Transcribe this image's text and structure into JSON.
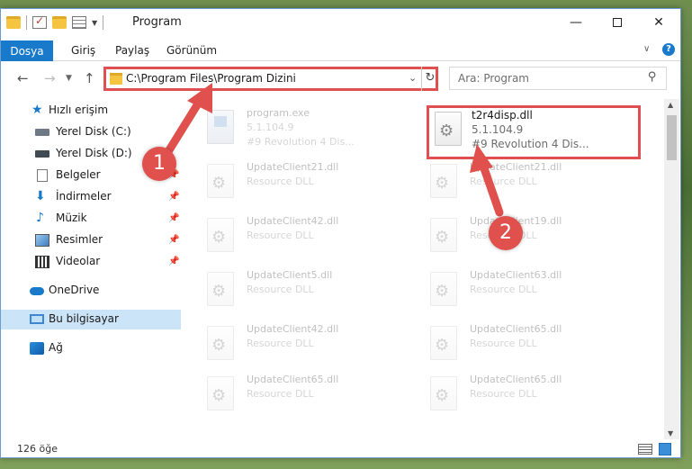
{
  "window": {
    "title": "Program",
    "controls": {
      "minimize": "—",
      "maximize": "",
      "close": "✕"
    }
  },
  "ribbon": {
    "tabs": [
      "Dosya",
      "Giriş",
      "Paylaş",
      "Görünüm"
    ],
    "help": "?"
  },
  "navigation": {
    "address_path": "C:\\Program Files\\Program Dizini",
    "search_placeholder": "Ara: Program"
  },
  "sidebar": {
    "quick_access": "Hızlı erişim",
    "items": [
      {
        "label": "Yerel Disk (C:)",
        "icon": "disk-icon",
        "pinned": false
      },
      {
        "label": "Yerel Disk (D:)",
        "icon": "disk-icon",
        "pinned": false
      },
      {
        "label": "Belgeler",
        "icon": "documents-icon",
        "pinned": true
      },
      {
        "label": "İndirmeler",
        "icon": "downloads-icon",
        "pinned": true
      },
      {
        "label": "Müzik",
        "icon": "music-icon",
        "pinned": true
      },
      {
        "label": "Resimler",
        "icon": "pictures-icon",
        "pinned": true
      },
      {
        "label": "Videolar",
        "icon": "videos-icon",
        "pinned": true
      }
    ],
    "onedrive": "OneDrive",
    "this_pc": "Bu bilgisayar",
    "network": "Ağ"
  },
  "files": [
    {
      "name": "program.exe",
      "line1": "5.1.104.9",
      "line2": "#9 Revolution 4 Dis...",
      "faded": true,
      "type": "exe"
    },
    {
      "name": "t2r4disp.dll",
      "line1": "5.1.104.9",
      "line2": "#9 Revolution 4 Dis...",
      "faded": false,
      "highlight": true,
      "type": "dll"
    },
    {
      "name": "UpdateClient21.dll",
      "line1": "Resource DLL",
      "faded": true
    },
    {
      "name": "UpdateClient21.dll",
      "line1": "Resource DLL",
      "faded": true
    },
    {
      "name": "UpdateClient42.dll",
      "line1": "Resource DLL",
      "faded": true
    },
    {
      "name": "UpdateClient19.dll",
      "line1": "Resource DLL",
      "faded": true
    },
    {
      "name": "UpdateClient5.dll",
      "line1": "Resource DLL",
      "faded": true
    },
    {
      "name": "UpdateClient63.dll",
      "line1": "Resource DLL",
      "faded": true
    },
    {
      "name": "UpdateClient42.dll",
      "line1": "Resource DLL",
      "faded": true
    },
    {
      "name": "UpdateClient65.dll",
      "line1": "Resource DLL",
      "faded": true
    },
    {
      "name": "UpdateClient65.dll",
      "line1": "Resource DLL",
      "faded": true
    },
    {
      "name": "UpdateClient65.dll",
      "line1": "Resource DLL",
      "faded": true
    }
  ],
  "status": {
    "item_count": "126 öğe"
  },
  "annotations": {
    "step1": "1",
    "step2": "2"
  },
  "colors": {
    "accent": "#1979ca",
    "highlight": "#e05050",
    "selected": "#cce4f7"
  }
}
